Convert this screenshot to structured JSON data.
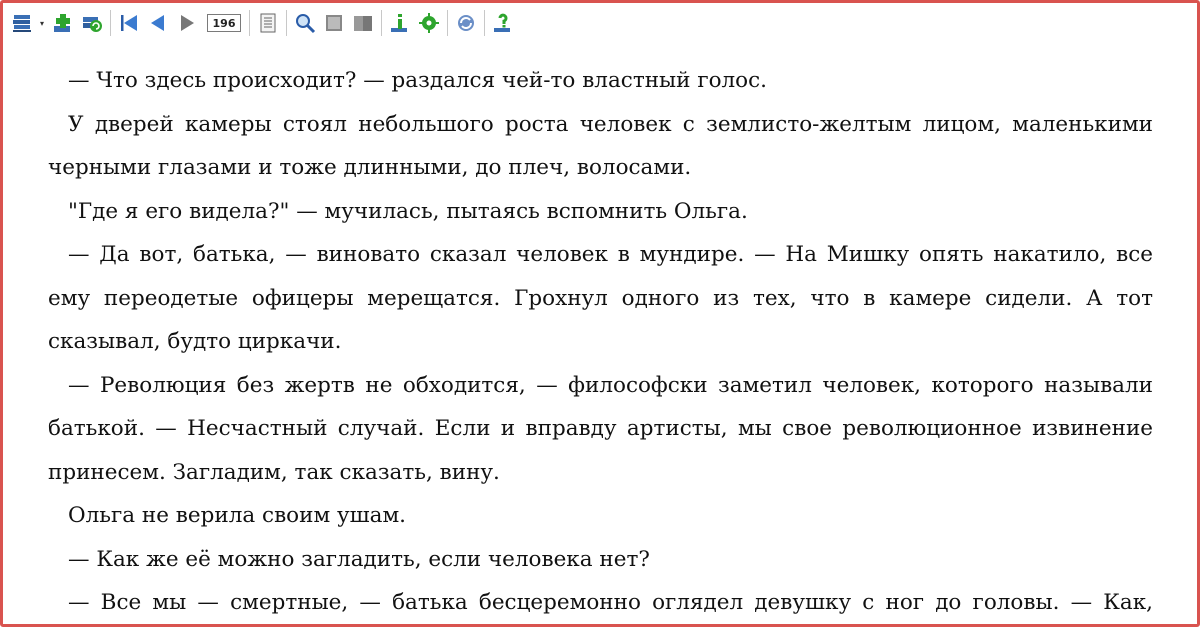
{
  "toolbar": {
    "page_number": "196",
    "icons": [
      "library-icon",
      "add-book-icon",
      "refresh-book-icon",
      "first-page-icon",
      "prev-page-icon",
      "next-page-icon",
      "page-view-icon",
      "search-icon",
      "book-view-icon",
      "two-page-icon",
      "info-icon",
      "settings-icon",
      "sync-icon",
      "help-icon"
    ]
  },
  "text": {
    "paragraphs": [
      "— Что здесь происходит? — раздался чей-то властный голос.",
      "У дверей камеры стоял небольшого роста человек с землисто-желтым лицом, маленькими черными глазами и тоже длинными, до плеч, волосами.",
      "\"Где я его видела?\" — мучилась, пытаясь вспомнить Ольга.",
      "— Да вот, батька, — виновато сказал человек в мундире. — На Мишку опять накатило, все ему переодетые офицеры мерещатся. Грохнул одного из тех, что в камере сидели. А тот сказывал, будто циркачи.",
      "— Революция без жертв не обходится, — философски заметил человек, которого называли батькой. — Несчастный случай. Если и вправду артисты, мы свое революционное извинение принесем. Загладим, так сказать, вину.",
      "Ольга не верила своим ушам.",
      "— Как же её можно загладить, если человека нет?",
      "— Все мы — смертные, — батька бесцеремонно оглядел девушку с ног до головы. — Как,"
    ]
  },
  "colors": {
    "frame_border": "#d9534f",
    "text": "#111111",
    "background": "#ffffff"
  }
}
